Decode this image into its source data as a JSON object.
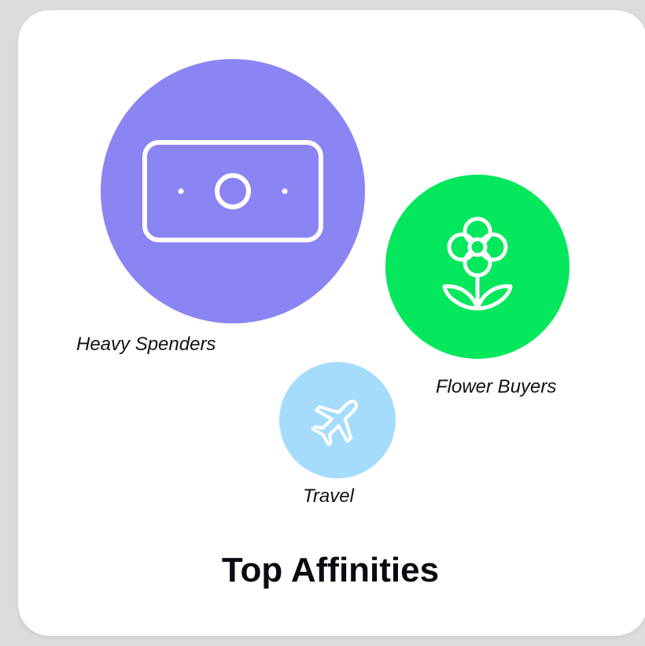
{
  "card": {
    "title": "Top Affinities"
  },
  "affinities": [
    {
      "label": "Heavy Spenders",
      "icon": "money-bill-icon",
      "color": "#8a85f3"
    },
    {
      "label": "Flower Buyers",
      "icon": "flower-icon",
      "color": "#05e75c"
    },
    {
      "label": "Travel",
      "icon": "airplane-icon",
      "color": "#a5dcfc"
    }
  ]
}
